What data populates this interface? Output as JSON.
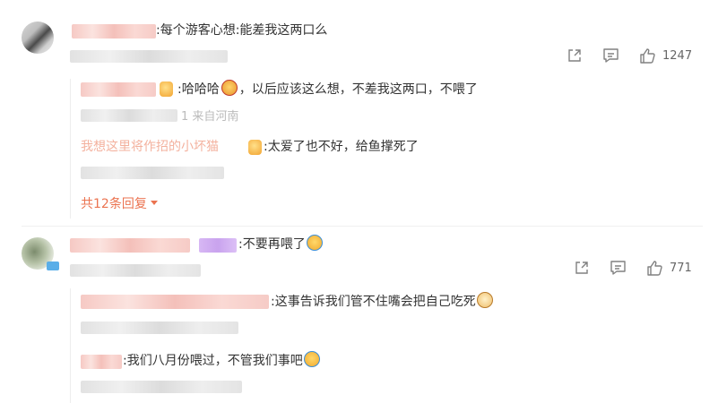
{
  "comments": [
    {
      "text": ":每个游客心想:能差我这两口么",
      "likes": "1247",
      "replies": [
        {
          "text": ":哈哈哈",
          "text2": "，以后应该这么想，不差我这两口，不喂了",
          "meta_fragment": "1 来自河南"
        },
        {
          "name": "我想这里将作招的小坏猫",
          "text": ":太爱了也不好，给鱼撑死了"
        }
      ],
      "more_label": "共12条回复"
    },
    {
      "text": ":不要再喂了",
      "likes": "771",
      "replies": [
        {
          "text": ":这事告诉我们管不住嘴会把自己吃死"
        },
        {
          "text": ":我们八月份喂过，不管我们事吧"
        }
      ]
    }
  ],
  "icons": {
    "share": "share-icon",
    "comment": "comment-icon",
    "like": "thumbs-up-icon",
    "more_arrow": "caret-down-icon"
  },
  "colors": {
    "accent": "#eb7350",
    "text": "#333333",
    "muted": "#666666"
  }
}
